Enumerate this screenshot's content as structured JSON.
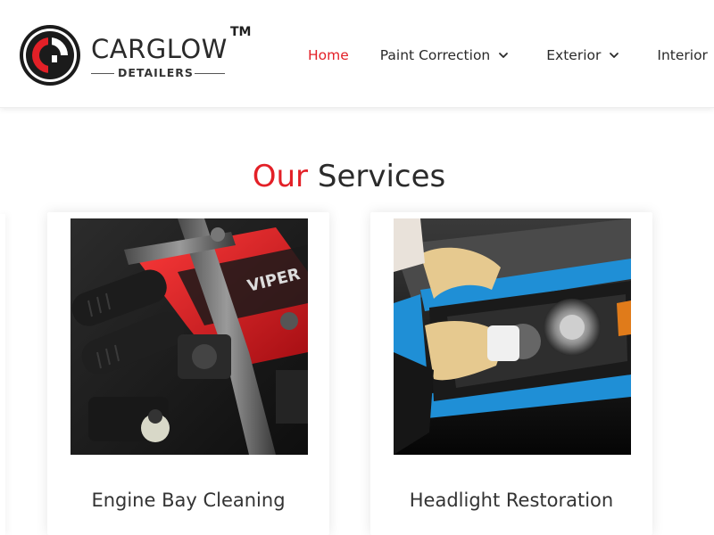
{
  "brand": {
    "name": "CARGLOW",
    "tm": "TM",
    "subtitle": "DETAILERS",
    "accent_color": "#e32027"
  },
  "nav": {
    "items": [
      {
        "label": "Home",
        "active": true,
        "has_dropdown": false
      },
      {
        "label": "Paint Correction",
        "active": false,
        "has_dropdown": true
      },
      {
        "label": "Exterior",
        "active": false,
        "has_dropdown": true
      },
      {
        "label": "Interior",
        "active": false,
        "has_dropdown": false
      }
    ]
  },
  "section": {
    "title_accent": "Our",
    "title_rest": "Services"
  },
  "services": [
    {
      "label": "Engine Bay Cleaning",
      "image": "engine-bay-photo"
    },
    {
      "label": "Headlight Restoration",
      "image": "headlight-restoration-photo"
    }
  ],
  "engine_badge": "VIPER"
}
